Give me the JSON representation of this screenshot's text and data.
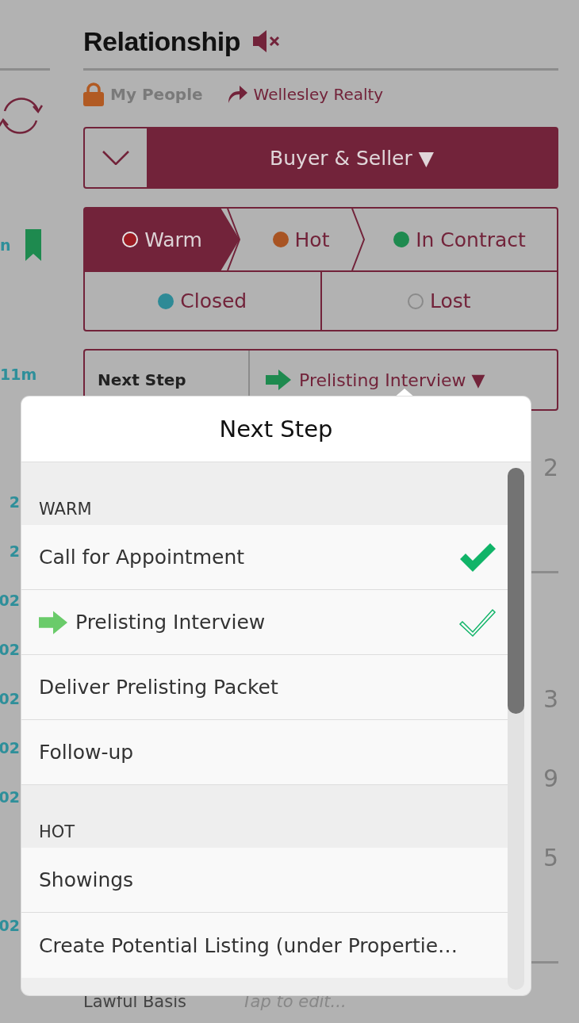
{
  "left_column": [
    {
      "kind": "sync"
    },
    {
      "kind": "bookmarked",
      "text": "n"
    },
    {
      "kind": "time",
      "text": "11m"
    },
    {
      "kind": "date",
      "text": "2"
    },
    {
      "kind": "date",
      "text": "2"
    },
    {
      "kind": "date",
      "text": "02"
    },
    {
      "kind": "date",
      "text": "02"
    },
    {
      "kind": "date",
      "text": "02"
    },
    {
      "kind": "date",
      "text": "02"
    },
    {
      "kind": "date",
      "text": "02"
    },
    {
      "kind": "date",
      "text": "02"
    }
  ],
  "header": {
    "title": "Relationship",
    "muted": true
  },
  "meta": {
    "owner": "My People",
    "company": "Wellesley Realty"
  },
  "relationship_type": {
    "value": "Buyer & Seller ▼"
  },
  "stages": [
    {
      "label": "Warm",
      "color": "#9b1b22",
      "hollow": false,
      "selected": true
    },
    {
      "label": "Hot",
      "color": "#a85423",
      "hollow": false,
      "selected": false
    },
    {
      "label": "In Contract",
      "color": "#1e8a4f",
      "hollow": false,
      "selected": false
    },
    {
      "label": "Closed",
      "color": "#2e8a96",
      "hollow": false,
      "selected": false
    },
    {
      "label": "Lost",
      "color": "#8a8a8a",
      "hollow": true,
      "selected": false
    }
  ],
  "next_step": {
    "label": "Next Step",
    "value": "Prelisting Interview ▼"
  },
  "right_values": [
    {
      "kind": "value",
      "text": "2"
    },
    {
      "kind": "rule"
    },
    {
      "kind": "value",
      "text": "3"
    },
    {
      "kind": "value",
      "text": "9"
    },
    {
      "kind": "value",
      "text": "5"
    },
    {
      "kind": "rule"
    }
  ],
  "lawful_basis": {
    "label": "Lawful Basis",
    "placeholder": "Tap to edit..."
  },
  "popover": {
    "title": "Next Step",
    "sections": [
      {
        "title": "WARM",
        "items": [
          {
            "label": "Call for Appointment",
            "selected": false,
            "done": true
          },
          {
            "label": "Prelisting Interview",
            "selected": true,
            "done": false
          },
          {
            "label": "Deliver Prelisting Packet",
            "selected": false,
            "done": false
          },
          {
            "label": "Follow-up",
            "selected": false,
            "done": false
          }
        ]
      },
      {
        "title": "HOT",
        "items": [
          {
            "label": "Showings",
            "selected": false,
            "done": false
          },
          {
            "label": "Create Potential Listing (under Propertie…",
            "selected": false,
            "done": false
          }
        ]
      }
    ]
  }
}
